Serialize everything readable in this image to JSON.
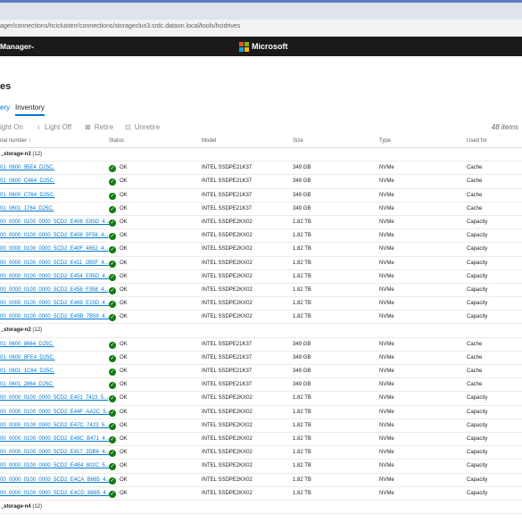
{
  "browser": {
    "url": "ager/connections/hciclusterr/connections/storageclus3.srdc.dataon.local/tools/hcidrives"
  },
  "app": {
    "name": "Manager",
    "brand": "Microsoft"
  },
  "page": {
    "title": "es"
  },
  "tabs": {
    "drives": "ery",
    "inventory": "Inventory"
  },
  "toolbar": {
    "light_on": "ight On",
    "light_off": "Light Off",
    "retire": "Retire",
    "unretire": "Unretire",
    "count": "48 items"
  },
  "columns": {
    "serial": "rial number ↑",
    "status": "Status",
    "model": "Model",
    "size": "Size",
    "type": "Type",
    "used_for": "Used for"
  },
  "groups": [
    {
      "name": "storage-n3",
      "count": "(12)",
      "rows": [
        {
          "serial": "01_0600_95E4_D25C.",
          "status": "OK",
          "model": "INTEL SSDPE21K37",
          "size": "349 GB",
          "type": "NVMe",
          "used_for": "Cache"
        },
        {
          "serial": "01_0600_C464_D25C.",
          "status": "OK",
          "model": "INTEL SSDPE21K37",
          "size": "349 GB",
          "type": "NVMe",
          "used_for": "Cache"
        },
        {
          "serial": "01_0600_C764_D25C.",
          "status": "OK",
          "model": "INTEL SSDPE21K37",
          "size": "349 GB",
          "type": "NVMe",
          "used_for": "Cache"
        },
        {
          "serial": "01_0601_1764_D25C.",
          "status": "OK",
          "model": "INTEL SSDPE21K37",
          "size": "349 GB",
          "type": "NVMe",
          "used_for": "Cache"
        },
        {
          "serial": "00_0000_0100_0000_5CD2_E408_E85D_4...",
          "status": "OK",
          "model": "INTEL SSDPE2KX02",
          "size": "1.82 TB",
          "type": "NVMe",
          "used_for": "Capacity"
        },
        {
          "serial": "00_0000_0100_0000_5CD2_E408_5F58_4...",
          "status": "OK",
          "model": "INTEL SSDPE2KX02",
          "size": "1.82 TB",
          "type": "NVMe",
          "used_for": "Capacity"
        },
        {
          "serial": "00_0000_0100_0000_5CD2_E40F_4652_4...",
          "status": "OK",
          "model": "INTEL SSDPE2KX02",
          "size": "1.82 TB",
          "type": "NVMe",
          "used_for": "Capacity"
        },
        {
          "serial": "00_0000_0100_0000_5CD2_E411_2B5F_4...",
          "status": "OK",
          "model": "INTEL SSDPE2KX02",
          "size": "1.82 TB",
          "type": "NVMe",
          "used_for": "Capacity"
        },
        {
          "serial": "00_0000_0100_0000_5CD2_E454_E95D_4...",
          "status": "OK",
          "model": "INTEL SSDPE2KX02",
          "size": "1.82 TB",
          "type": "NVMe",
          "used_for": "Capacity"
        },
        {
          "serial": "00_0000_0100_0000_5CD2_E458_F358_4...",
          "status": "OK",
          "model": "INTEL SSDPE2KX02",
          "size": "1.82 TB",
          "type": "NVMe",
          "used_for": "Capacity"
        },
        {
          "serial": "00_0000_0100_0000_5CD2_E469_E15D_4...",
          "status": "OK",
          "model": "INTEL SSDPE2KX02",
          "size": "1.82 TB",
          "type": "NVMe",
          "used_for": "Capacity"
        },
        {
          "serial": "00_0000_0100_0000_5CD2_E49B_7B59_4...",
          "status": "OK",
          "model": "INTEL SSDPE2KX02",
          "size": "1.82 TB",
          "type": "NVMe",
          "used_for": "Capacity"
        }
      ]
    },
    {
      "name": "storage-n2",
      "count": "(12)",
      "rows": [
        {
          "serial": "01_0600_8664_D25C.",
          "status": "OK",
          "model": "INTEL SSDPE21K37",
          "size": "349 GB",
          "type": "NVMe",
          "used_for": "Cache"
        },
        {
          "serial": "01_0600_8FE4_D25C.",
          "status": "OK",
          "model": "INTEL SSDPE21K37",
          "size": "349 GB",
          "type": "NVMe",
          "used_for": "Cache"
        },
        {
          "serial": "01_0601_1C64_D25C.",
          "status": "OK",
          "model": "INTEL SSDPE21K37",
          "size": "349 GB",
          "type": "NVMe",
          "used_for": "Cache"
        },
        {
          "serial": "01_0601_2864_D25C.",
          "status": "OK",
          "model": "INTEL SSDPE21K37",
          "size": "349 GB",
          "type": "NVMe",
          "used_for": "Cache"
        },
        {
          "serial": "00_0000_0100_0000_5CD2_E401_7423_5...",
          "status": "OK",
          "model": "INTEL SSDPE2KX02",
          "size": "1.82 TB",
          "type": "NVMe",
          "used_for": "Capacity"
        },
        {
          "serial": "00_0000_0100_0000_5CD2_E44F_AA2C_5...",
          "status": "OK",
          "model": "INTEL SSDPE2KX02",
          "size": "1.82 TB",
          "type": "NVMe",
          "used_for": "Capacity"
        },
        {
          "serial": "00_0000_0100_0000_5CD2_E47C_7423_5...",
          "status": "OK",
          "model": "INTEL SSDPE2KX02",
          "size": "1.82 TB",
          "type": "NVMe",
          "used_for": "Capacity"
        },
        {
          "serial": "00_0000_0100_0000_5CD2_E49C_B471_4...",
          "status": "OK",
          "model": "INTEL SSDPE2KX02",
          "size": "1.82 TB",
          "type": "NVMe",
          "used_for": "Capacity"
        },
        {
          "serial": "00_0000_0100_0000_5CD2_E417_2DB6_4...",
          "status": "OK",
          "model": "INTEL SSDPE2KX02",
          "size": "1.82 TB",
          "type": "NVMe",
          "used_for": "Capacity"
        },
        {
          "serial": "00_0000_0100_0000_5CD2_E4B4_802C_5...",
          "status": "OK",
          "model": "INTEL SSDPE2KX02",
          "size": "1.82 TB",
          "type": "NVMe",
          "used_for": "Capacity"
        },
        {
          "serial": "00_0000_0100_0000_5CD2_E4CA_B885_4...",
          "status": "OK",
          "model": "INTEL SSDPE2KX02",
          "size": "1.82 TB",
          "type": "NVMe",
          "used_for": "Capacity"
        },
        {
          "serial": "00_0000_0100_0000_5CD2_E4CD_B885_4...",
          "status": "OK",
          "model": "INTEL SSDPE2KX02",
          "size": "1.82 TB",
          "type": "NVMe",
          "used_for": "Capacity"
        }
      ]
    },
    {
      "name": "storage-n4",
      "count": "(12)",
      "rows": []
    }
  ]
}
